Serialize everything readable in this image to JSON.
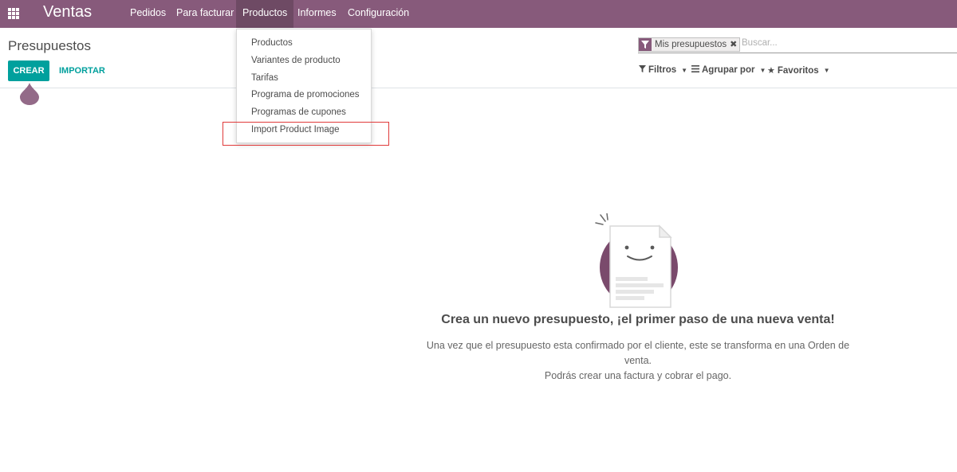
{
  "navbar": {
    "app_name": "Ventas",
    "menu": [
      {
        "label": "Pedidos"
      },
      {
        "label": "Para facturar"
      },
      {
        "label": "Productos"
      },
      {
        "label": "Informes"
      },
      {
        "label": "Configuración"
      }
    ],
    "active_menu": "Productos",
    "bg_color": "#875a7b"
  },
  "control_panel": {
    "title": "Presupuestos",
    "create_label": "CREAR",
    "import_label": "IMPORTAR",
    "search": {
      "facet_label": "Mis presupuestos",
      "facet_remove": "✖",
      "placeholder": "Buscar..."
    },
    "filters_label": "Filtros",
    "groupby_label": "Agrupar por",
    "favorites_label": "Favoritos"
  },
  "dropdown": {
    "items": [
      {
        "label": "Productos"
      },
      {
        "label": "Variantes de producto"
      },
      {
        "label": "Tarifas"
      },
      {
        "label": "Programa de promociones"
      },
      {
        "label": "Programas de cupones"
      },
      {
        "label": "Import Product Image"
      }
    ],
    "highlighted_item": "Import Product Image",
    "highlight_color": "#e03a3a"
  },
  "empty_state": {
    "title": "Crea un nuevo presupuesto, ¡el primer paso de una nueva venta!",
    "body_line1": "Una vez que el presupuesto esta confirmado por el cliente, este se transforma en una Orden de venta.",
    "body_line2": "Podrás crear una factura y cobrar el pago.",
    "icon": "smiling-document-icon"
  },
  "colors": {
    "primary": "#00a09d",
    "brand": "#875a7b"
  }
}
